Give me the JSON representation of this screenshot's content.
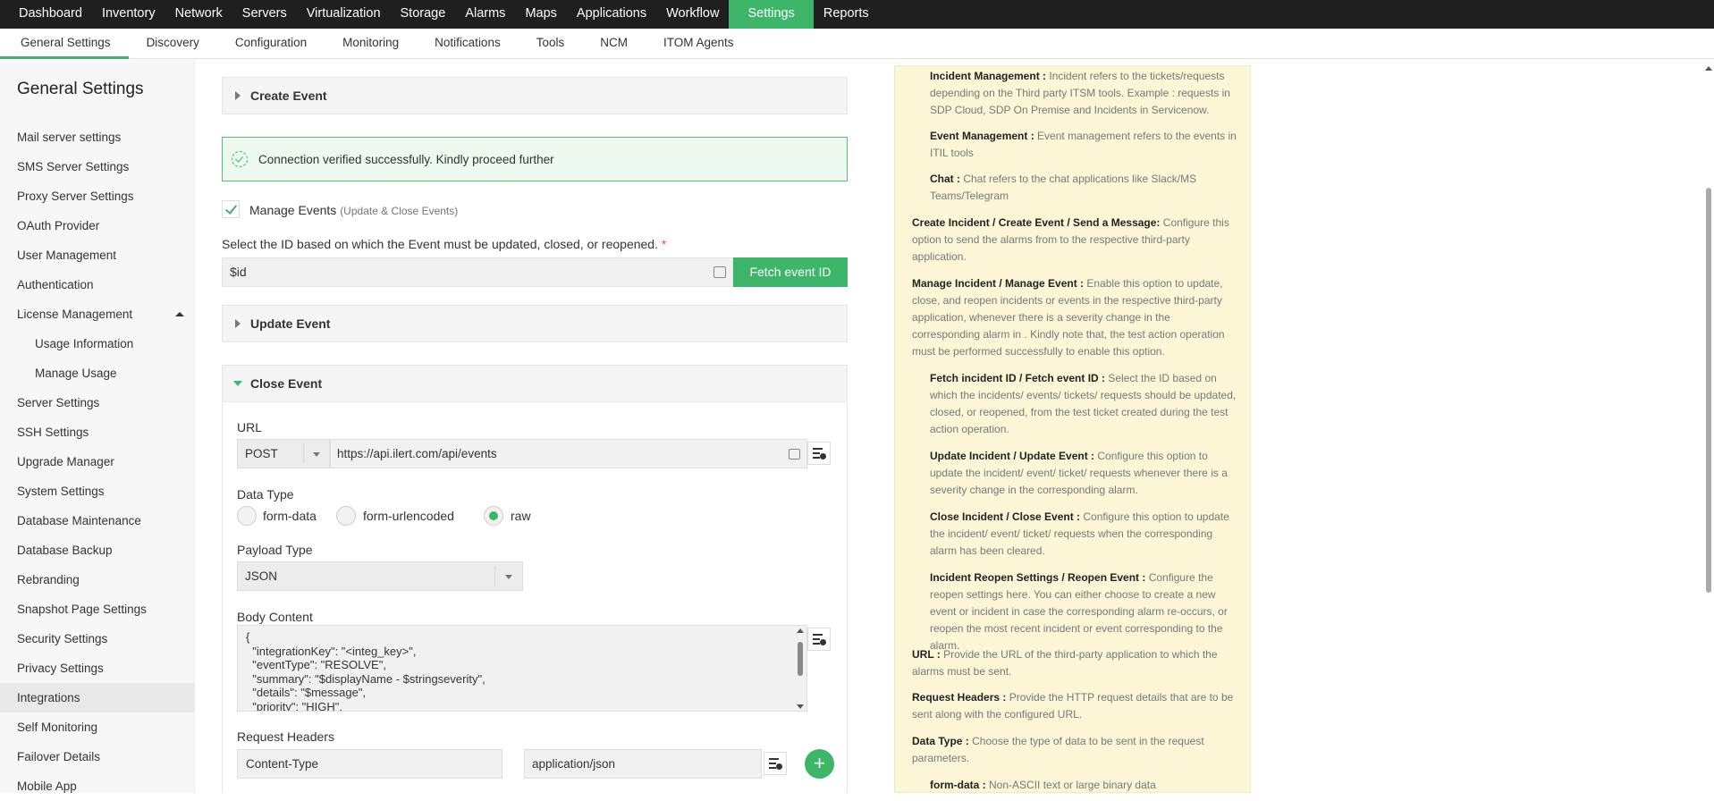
{
  "topnav": {
    "items": [
      "Dashboard",
      "Inventory",
      "Network",
      "Servers",
      "Virtualization",
      "Storage",
      "Alarms",
      "Maps",
      "Applications",
      "Workflow",
      "Settings",
      "Reports"
    ],
    "active": "Settings"
  },
  "subnav": {
    "items": [
      "General Settings",
      "Discovery",
      "Configuration",
      "Monitoring",
      "Notifications",
      "Tools",
      "NCM",
      "ITOM Agents"
    ],
    "active": "General Settings"
  },
  "sidebar": {
    "title": "General Settings",
    "items": [
      "Mail server settings",
      "SMS Server Settings",
      "Proxy Server Settings",
      "OAuth Provider",
      "User Management",
      "Authentication",
      "License Management",
      "Usage Information",
      "Manage Usage",
      "Server Settings",
      "SSH Settings",
      "Upgrade Manager",
      "System Settings",
      "Database Maintenance",
      "Database Backup",
      "Rebranding",
      "Snapshot Page Settings",
      "Security Settings",
      "Privacy Settings",
      "Integrations",
      "Self Monitoring",
      "Failover Details",
      "Mobile App"
    ],
    "active": "Integrations"
  },
  "main": {
    "create_event": "Create Event",
    "success_msg": "Connection verified successfully. Kindly proceed further",
    "manage_events": "Manage Events",
    "manage_events_sub": "(Update & Close Events)",
    "id_label": "Select the ID based on which the Event must be updated, closed, or reopened.",
    "id_required": "*",
    "id_value": "$id",
    "fetch_btn": "Fetch event ID",
    "update_event": "Update Event",
    "close_event": "Close Event",
    "url_label": "URL",
    "method": "POST",
    "url_value": "https://api.ilert.com/api/events",
    "data_type_label": "Data Type",
    "data_types": [
      "form-data",
      "form-urlencoded",
      "raw"
    ],
    "data_type_selected": "raw",
    "payload_label": "Payload Type",
    "payload_value": "JSON",
    "body_label": "Body Content",
    "body_lines": [
      "{",
      "  \"integrationKey\": \"<integ_key>\",",
      "  \"eventType\": \"RESOLVE\",",
      "  \"summary\": \"$displayName - $stringseverity\",",
      "  \"details\": \"$message\",",
      "  \"priority\": \"HIGH\","
    ],
    "headers_label": "Request Headers",
    "header_key": "Content-Type",
    "header_value": "application/json",
    "add_symbol": "+"
  },
  "help": {
    "items": [
      {
        "t": "Incident Management :",
        "d": "Incident refers to the tickets/requests depending on the Third party ITSM tools. Example : requests in SDP Cloud, SDP On Premise and Incidents in Servicenow."
      },
      {
        "t": "Event Management :",
        "d": "Event management refers to the events in ITIL tools"
      },
      {
        "t": "Chat :",
        "d": "Chat refers to the chat applications like Slack/MS Teams/Telegram"
      },
      {
        "t": "Create Incident / Create Event / Send a Message:",
        "d": "Configure this option to send the alarms from  to the respective third-party application."
      },
      {
        "t": "Manage Incident / Manage Event :",
        "d": "Enable this option to update, close, and reopen incidents or events in the respective third-party application, whenever there is a severity change in the corresponding alarm in . Kindly note that, the test action operation must be performed successfully to enable this option."
      },
      {
        "t": "Fetch incident ID / Fetch event ID :",
        "d": "Select the ID based on which the incidents/ events/ tickets/ requests should be updated, closed, or reopened, from the test ticket created during the test action operation."
      },
      {
        "t": "Update Incident / Update Event :",
        "d": "Configure this option to update the incident/ event/ ticket/ requests whenever there is a severity change in the corresponding alarm."
      },
      {
        "t": "Close Incident / Close Event :",
        "d": "Configure this option to update the incident/ event/ ticket/ requests when the corresponding alarm has been cleared."
      },
      {
        "t": "Incident Reopen Settings / Reopen Event :",
        "d": "Configure the reopen settings here. You can either choose to create a new event or incident in case the corresponding alarm re-occurs, or reopen the most recent incident or event corresponding to the alarm."
      },
      {
        "t": "URL :",
        "d": " Provide the URL of the third-party application to which the alarms must be sent."
      },
      {
        "t": "Request Headers :",
        "d": " Provide the HTTP request details that are to be sent along with the configured URL."
      },
      {
        "t": "Data Type :",
        "d": "Choose the type of data to be sent in the request parameters."
      },
      {
        "t": "form-data :",
        "d": "Non-ASCII text or large binary data"
      }
    ]
  },
  "colors": {
    "accent": "#3db66a",
    "nav_bg": "#1f1f1f",
    "help_bg": "#fdf6d6"
  }
}
